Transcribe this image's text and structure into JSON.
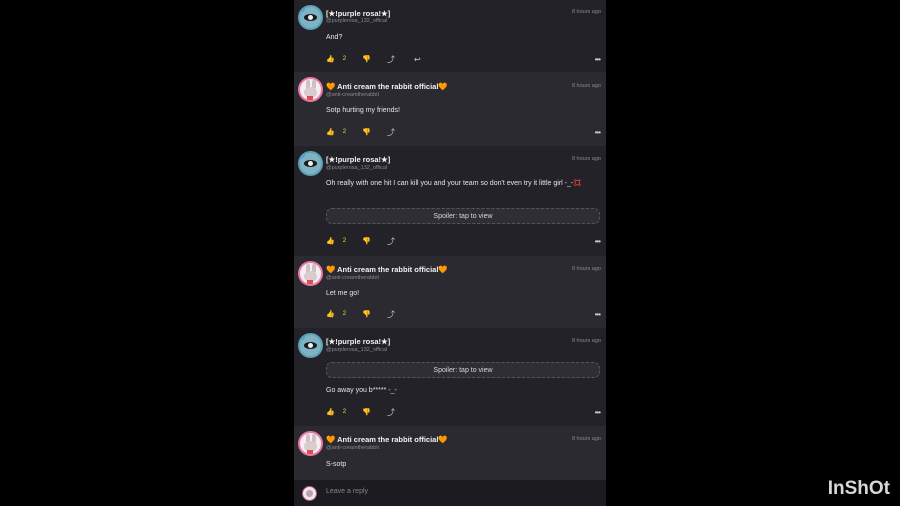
{
  "comments": [
    {
      "name": "[★!purple rosa!★]",
      "handle": "@purplerosa_132_offical",
      "time": "8 hours ago",
      "text": "And?",
      "likes": "2"
    },
    {
      "name": "🧡 Anti cream the rabbit official🧡",
      "handle": "@anti-creamtherabbit",
      "time": "8 hours ago",
      "text": "Sotp hurting my friends!",
      "likes": "2"
    },
    {
      "name": "[★!purple rosa!★]",
      "handle": "@purplerosa_132_offical",
      "time": "8 hours ago",
      "text": "Oh really with one hit I can kill you and your team so don't even try it little girl -_-💢",
      "spoiler": "Spoiler: tap to view",
      "likes": "2"
    },
    {
      "name": "🧡 Anti cream the rabbit official🧡",
      "handle": "@anti-creamtherabbit",
      "time": "8 hours ago",
      "text": "Let me go!",
      "likes": "2"
    },
    {
      "name": "[★!purple rosa!★]",
      "handle": "@purplerosa_132_offical",
      "time": "8 hours ago",
      "spoiler": "Spoiler: tap to view",
      "text": "Go away you b***** -_-",
      "likes": "2"
    },
    {
      "name": "🧡 Anti cream the rabbit official🧡",
      "handle": "@anti-creamtherabbit",
      "time": "8 hours ago",
      "text": "S-sotp"
    }
  ],
  "footer": {
    "placeholder": "Leave a reply"
  },
  "watermark": "InShOt",
  "icons": {
    "like": "thumbs-up-icon",
    "dislike": "thumbs-down-icon",
    "share": "share-icon",
    "reply": "reply-icon",
    "more": "more-icon"
  },
  "colors": {
    "like_accent": "#e8e22f",
    "bg": "#232228"
  }
}
